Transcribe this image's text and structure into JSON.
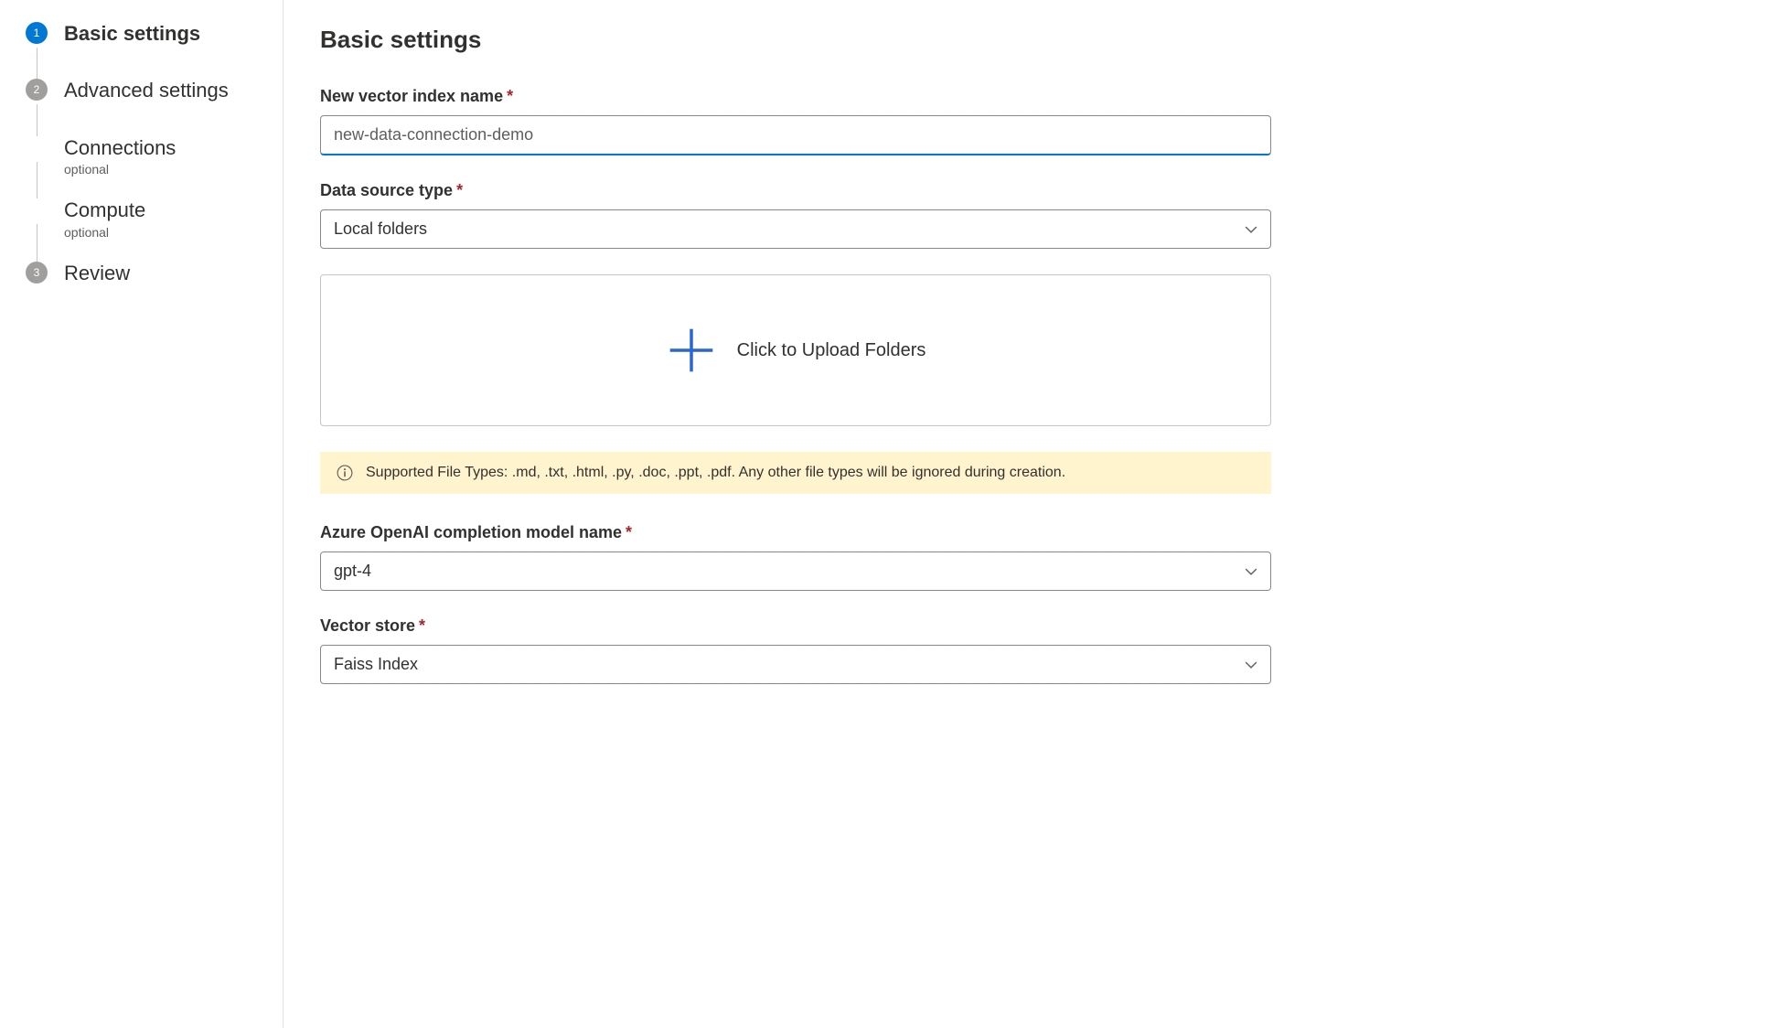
{
  "sidebar": {
    "steps": [
      {
        "num": "1",
        "label": "Basic settings",
        "active": true
      },
      {
        "num": "2",
        "label": "Advanced settings",
        "active": false
      },
      {
        "num": "",
        "label": "Connections",
        "sub": "optional",
        "substep": true
      },
      {
        "num": "",
        "label": "Compute",
        "sub": "optional",
        "substep": true
      },
      {
        "num": "3",
        "label": "Review",
        "active": false
      }
    ]
  },
  "main": {
    "title": "Basic settings",
    "index_name": {
      "label": "New vector index name",
      "value": "new-data-connection-demo"
    },
    "data_source": {
      "label": "Data source type",
      "value": "Local folders"
    },
    "upload": {
      "text": "Click to Upload Folders"
    },
    "info": {
      "text": "Supported File Types: .md, .txt, .html, .py, .doc, .ppt, .pdf. Any other file types will be ignored during creation."
    },
    "completion_model": {
      "label": "Azure OpenAI completion model name",
      "value": "gpt-4"
    },
    "vector_store": {
      "label": "Vector store",
      "value": "Faiss Index"
    }
  }
}
